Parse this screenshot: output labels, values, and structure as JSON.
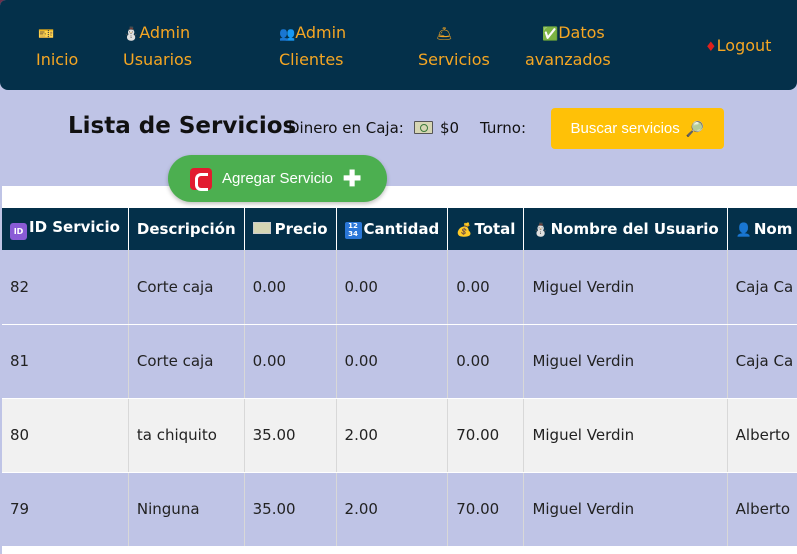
{
  "nav": {
    "items": [
      {
        "icon": "🎫",
        "label": "Inicio",
        "icon_name": "ticket-icon"
      },
      {
        "icon": "⛄",
        "label": "Admin Usuarios",
        "line1": "Admin",
        "line2": "Usuarios",
        "icon_name": "snowman-icon"
      },
      {
        "icon": "👥",
        "label": "Admin Clientes",
        "line1": "Admin",
        "line2": "Clientes",
        "icon_name": "people-icon"
      },
      {
        "icon": "🛎",
        "label": "Servicios",
        "icon_name": "bell-icon"
      },
      {
        "icon": "✅",
        "label": "Datos avanzados",
        "line1": "Datos",
        "line2": "avanzados",
        "icon_name": "checkmark-icon"
      },
      {
        "icon": "♦",
        "label": "Logout",
        "icon_name": "diamond-icon"
      }
    ]
  },
  "header": {
    "title": "Lista de Servicios",
    "cash_label": "Dinero en Caja:",
    "cash_value": "$0",
    "turno_label": "Turno:",
    "search_label": "Buscar servicios",
    "search_icon": "🔎",
    "add_label": "Agregar Servicio"
  },
  "table": {
    "columns": [
      {
        "label": "ID Servicio",
        "icon": "id-badge-icon"
      },
      {
        "label": "Descripción",
        "icon": ""
      },
      {
        "label": "Precio",
        "icon": "money-icon"
      },
      {
        "label": "Cantidad",
        "icon": "numbers-icon"
      },
      {
        "label": "Total",
        "icon": "money-bag-icon"
      },
      {
        "label": "Nombre del Usuario",
        "icon": "snowman-icon"
      },
      {
        "label": "Nom",
        "icon": "person-icon"
      }
    ],
    "rows": [
      [
        "82",
        "Corte caja",
        "0.00",
        "0.00",
        "0.00",
        "Miguel Verdin",
        "Caja Ca"
      ],
      [
        "81",
        "Corte caja",
        "0.00",
        "0.00",
        "0.00",
        "Miguel Verdin",
        "Caja Ca"
      ],
      [
        "80",
        "ta chiquito",
        "35.00",
        "2.00",
        "70.00",
        "Miguel Verdin",
        "Alberto"
      ],
      [
        "79",
        "Ninguna",
        "35.00",
        "2.00",
        "70.00",
        "Miguel Verdin",
        "Alberto"
      ]
    ]
  },
  "colors": {
    "nav_bg": "#04304a",
    "accent": "#f5a623",
    "page_bg": "#bfc4e6",
    "search_btn": "#ffc107",
    "add_btn": "#4caf50"
  }
}
